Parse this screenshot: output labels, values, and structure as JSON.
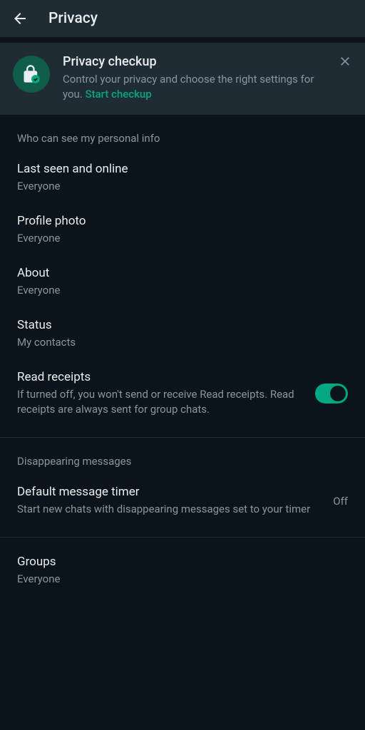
{
  "header": {
    "title": "Privacy"
  },
  "checkup": {
    "title": "Privacy checkup",
    "description": "Control your privacy and choose the right settings for you. ",
    "link": "Start checkup"
  },
  "sections": {
    "personalInfo": {
      "header": "Who can see my personal info",
      "lastSeen": {
        "title": "Last seen and online",
        "value": "Everyone"
      },
      "profilePhoto": {
        "title": "Profile photo",
        "value": "Everyone"
      },
      "about": {
        "title": "About",
        "value": "Everyone"
      },
      "status": {
        "title": "Status",
        "value": "My contacts"
      },
      "readReceipts": {
        "title": "Read receipts",
        "description": "If turned off, you won't send or receive Read receipts. Read receipts are always sent for group chats."
      }
    },
    "disappearing": {
      "header": "Disappearing messages",
      "timer": {
        "title": "Default message timer",
        "description": "Start new chats with disappearing messages set to your timer",
        "value": "Off"
      }
    },
    "groups": {
      "title": "Groups",
      "value": "Everyone"
    }
  }
}
